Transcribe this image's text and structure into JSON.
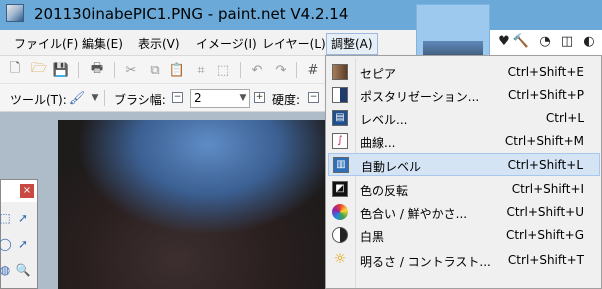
{
  "window": {
    "title": "201130inabePIC1.PNG - paint.net V4.2.14"
  },
  "menubar": {
    "items": [
      {
        "label": "ファイル(F)"
      },
      {
        "label": "編集(E)"
      },
      {
        "label": "表示(V)"
      },
      {
        "label": "イメージ(I)"
      },
      {
        "label": "レイヤー(L)"
      },
      {
        "label": "調整(A)"
      }
    ],
    "active_index": 5
  },
  "toolbar": {
    "tool_label": "ツール(T):",
    "brush_width_label": "ブラシ幅:",
    "brush_width_value": "2",
    "hardness_label": "硬度:"
  },
  "adjustments_menu": {
    "items": [
      {
        "label": "セピア",
        "shortcut": "Ctrl+Shift+E",
        "icon": "sepia-icon"
      },
      {
        "label": "ポスタリゼーション...",
        "shortcut": "Ctrl+Shift+P",
        "icon": "posterize-icon"
      },
      {
        "label": "レベル...",
        "shortcut": "Ctrl+L",
        "icon": "levels-icon"
      },
      {
        "label": "曲線...",
        "shortcut": "Ctrl+Shift+M",
        "icon": "curves-icon"
      },
      {
        "label": "自動レベル",
        "shortcut": "Ctrl+Shift+L",
        "icon": "auto-level-icon",
        "highlighted": true
      },
      {
        "label": "色の反転",
        "shortcut": "Ctrl+Shift+I",
        "icon": "invert-colors-icon"
      },
      {
        "label": "色合い / 鮮やかさ...",
        "shortcut": "Ctrl+Shift+U",
        "icon": "hue-saturation-icon"
      },
      {
        "label": "白黒",
        "shortcut": "Ctrl+Shift+G",
        "icon": "black-and-white-icon"
      },
      {
        "label": "明るさ / コントラスト...",
        "shortcut": "Ctrl+Shift+T",
        "icon": "brightness-contrast-icon"
      }
    ]
  },
  "colors": {
    "titlebar": "#6aa9d8",
    "highlight": "#d5e4f5",
    "workspace": "#aebbc9"
  }
}
